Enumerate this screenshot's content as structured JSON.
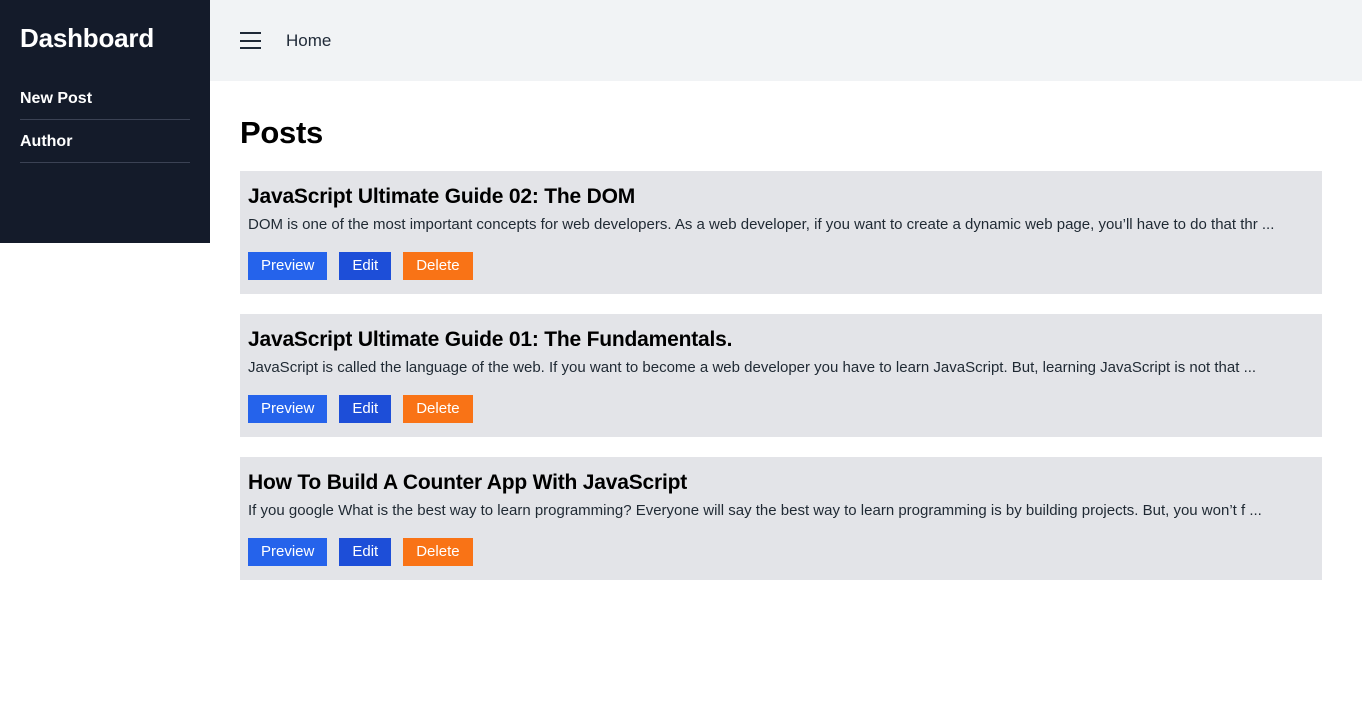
{
  "sidebar": {
    "title": "Dashboard",
    "items": [
      {
        "label": "New Post"
      },
      {
        "label": "Author"
      }
    ]
  },
  "header": {
    "menu_icon": "hamburger-icon",
    "title": "Home"
  },
  "main": {
    "page_title": "Posts",
    "posts": [
      {
        "title": "JavaScript Ultimate Guide 02: The DOM",
        "excerpt": "DOM is one of the most important concepts for web developers. As a web developer, if you want to create a dynamic web page, you’ll have to do that thr ...",
        "actions": [
          {
            "label": "Preview",
            "style": "preview"
          },
          {
            "label": "Edit",
            "style": "edit"
          },
          {
            "label": "Delete",
            "style": "delete"
          }
        ]
      },
      {
        "title": "JavaScript Ultimate Guide 01: The Fundamentals.",
        "excerpt": "JavaScript is called the language of the web. If you want to become a web developer you have to learn JavaScript. But, learning JavaScript is not that ...",
        "actions": [
          {
            "label": "Preview",
            "style": "preview"
          },
          {
            "label": "Edit",
            "style": "edit"
          },
          {
            "label": "Delete",
            "style": "delete"
          }
        ]
      },
      {
        "title": "How To Build A Counter App With JavaScript",
        "excerpt": "If you google What is the best way to learn programming? Everyone will say the best way to learn programming is by building projects. But, you won’t f ...",
        "actions": [
          {
            "label": "Preview",
            "style": "preview"
          },
          {
            "label": "Edit",
            "style": "edit"
          },
          {
            "label": "Delete",
            "style": "delete"
          }
        ]
      }
    ]
  },
  "colors": {
    "sidebar_bg": "#141b2a",
    "header_bg": "#f1f3f5",
    "card_bg": "#e3e4e8",
    "preview_btn": "#2563eb",
    "edit_btn": "#1d4ed8",
    "delete_btn": "#f97316"
  }
}
